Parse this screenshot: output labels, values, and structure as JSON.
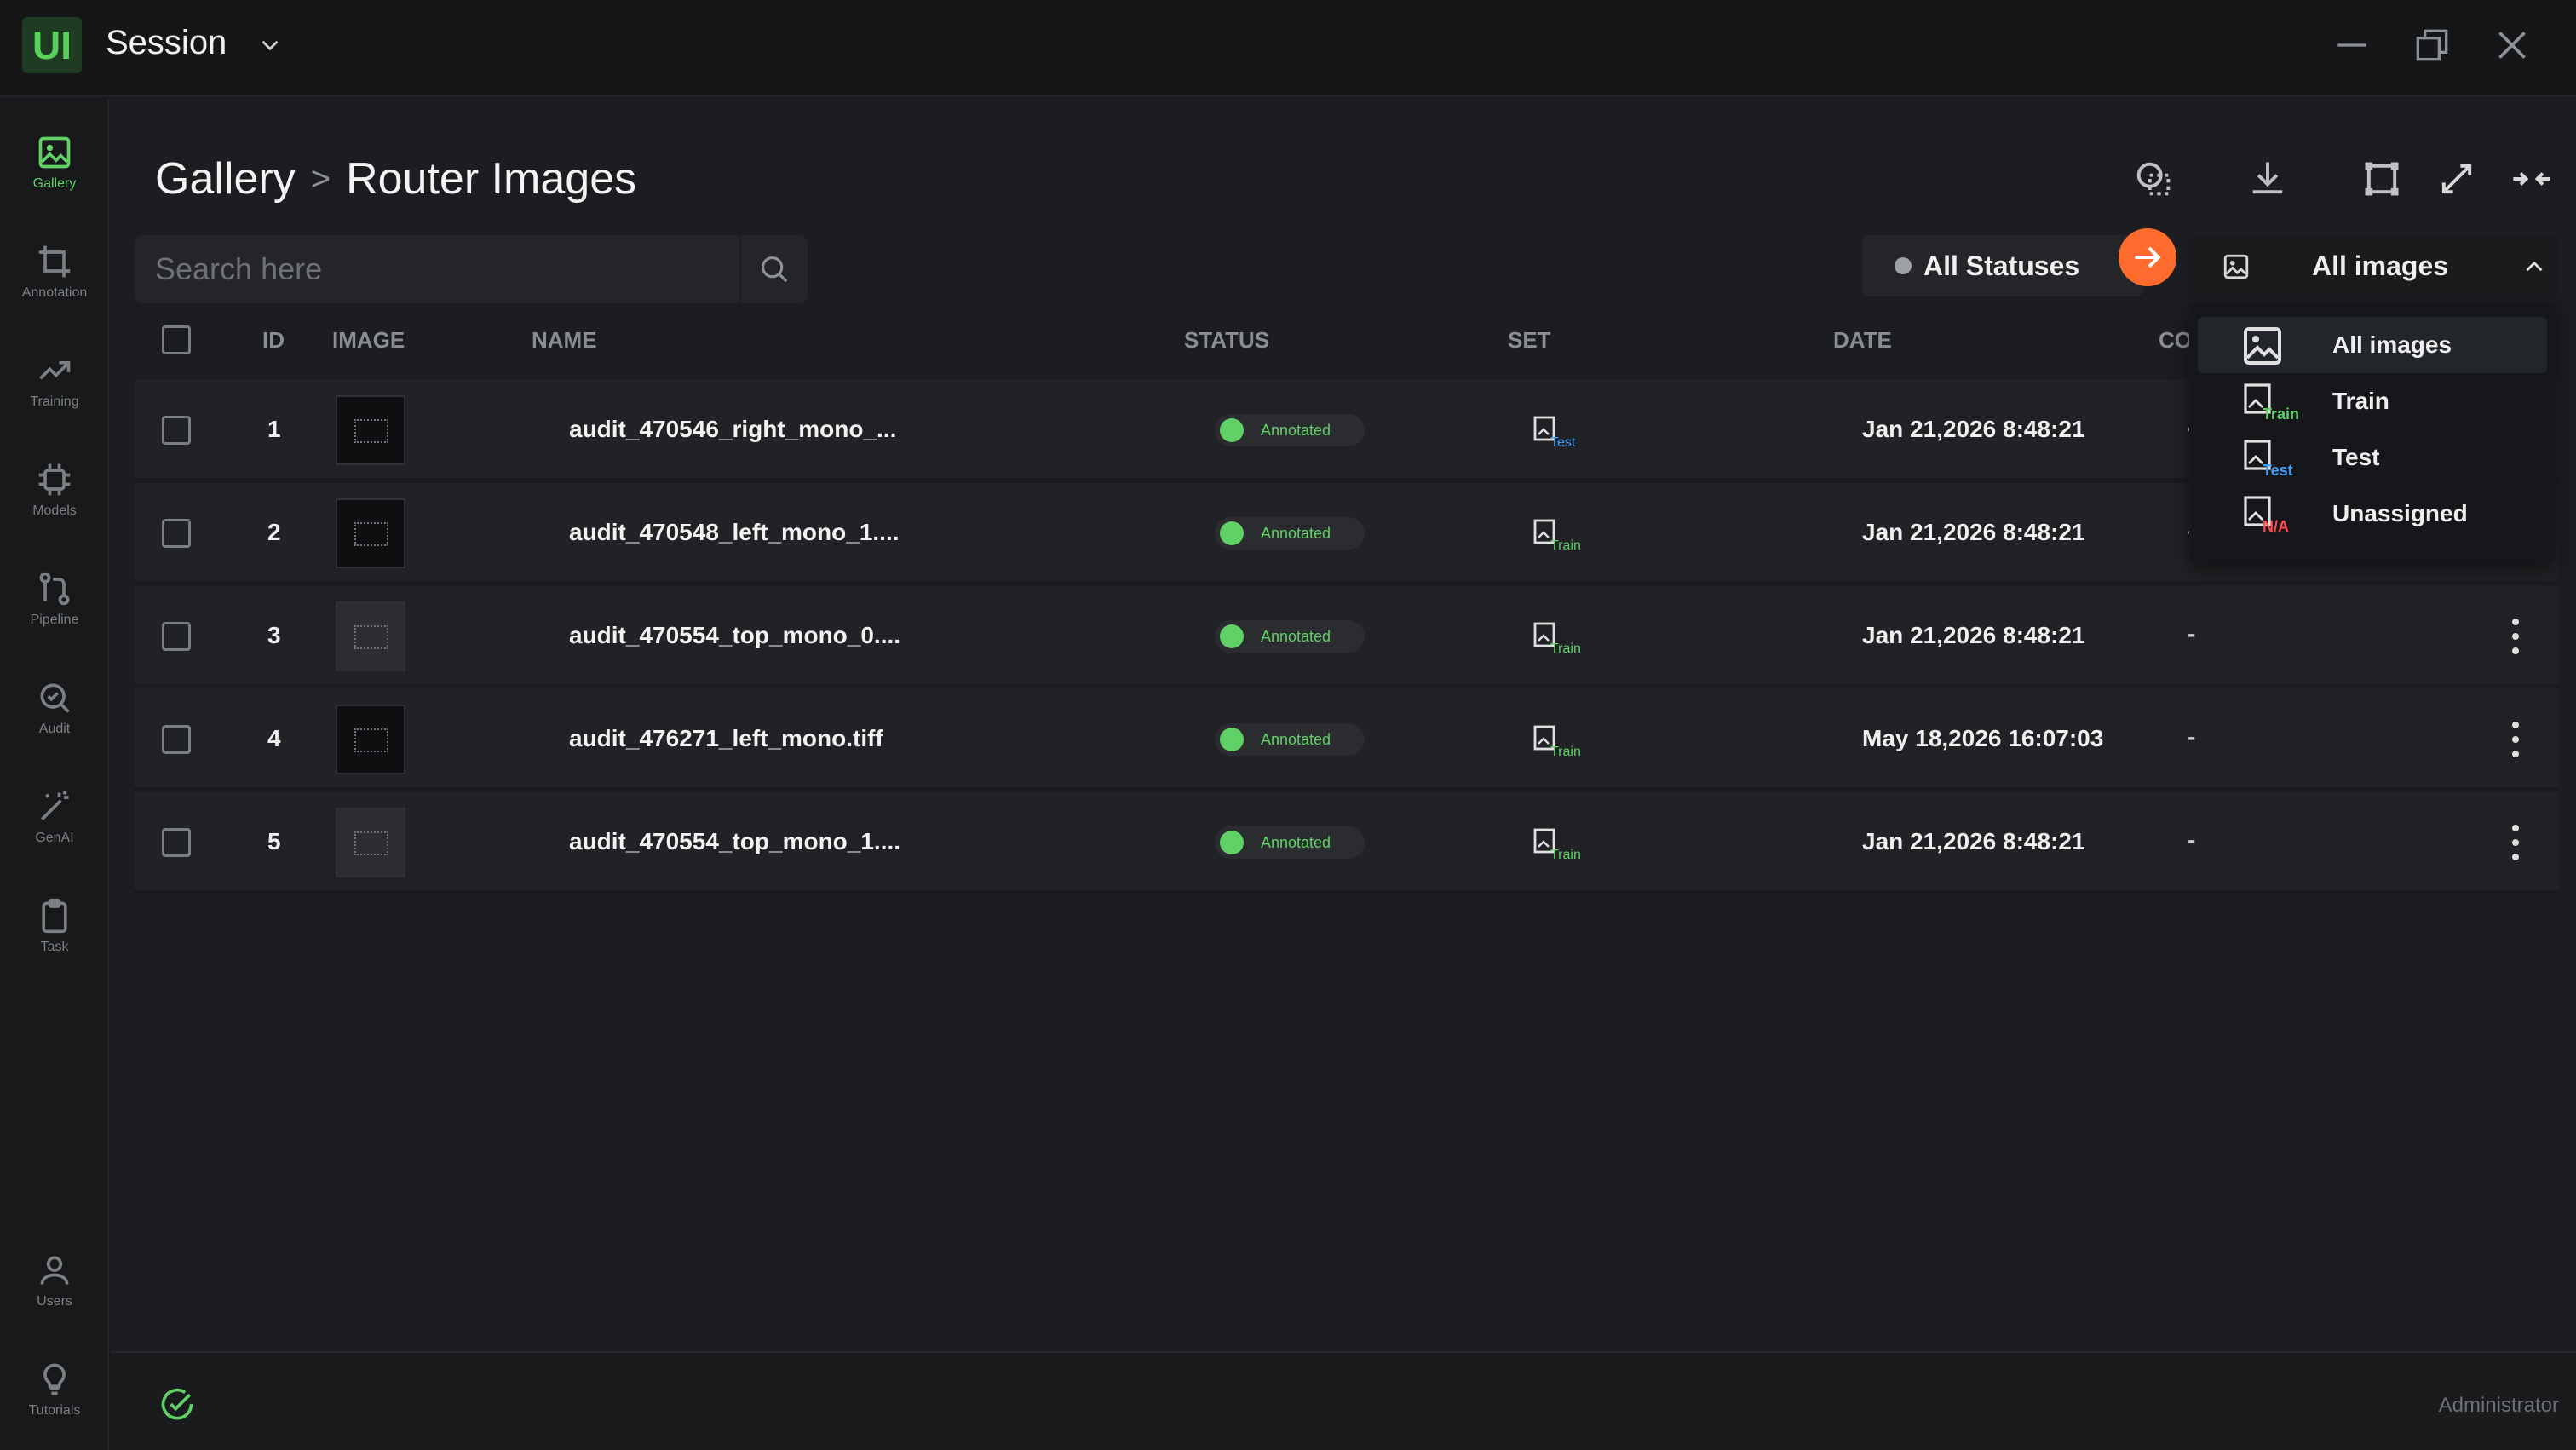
{
  "app": {
    "logo_text": "UI",
    "session_label": "Session"
  },
  "sidebar": {
    "items": [
      {
        "label": "Gallery",
        "icon": "gallery-icon",
        "active": true
      },
      {
        "label": "Annotation",
        "icon": "crop-icon"
      },
      {
        "label": "Training",
        "icon": "trend-icon"
      },
      {
        "label": "Models",
        "icon": "chip-icon"
      },
      {
        "label": "Pipeline",
        "icon": "pipeline-icon"
      },
      {
        "label": "Audit",
        "icon": "audit-search-icon"
      },
      {
        "label": "GenAI",
        "icon": "wand-icon"
      },
      {
        "label": "Task",
        "icon": "clipboard-icon"
      },
      {
        "label": "Users",
        "icon": "user-icon"
      },
      {
        "label": "Tutorials",
        "icon": "lightbulb-icon"
      }
    ]
  },
  "header": {
    "crumb_root": "Gallery",
    "crumb_sep": ">",
    "crumb_current": "Router Images"
  },
  "search": {
    "placeholder": "Search here"
  },
  "filters": {
    "status_label": "All Statuses",
    "images_label": "All images"
  },
  "table": {
    "columns": {
      "id": "ID",
      "image": "IMAGE",
      "name": "NAME",
      "status": "STATUS",
      "set": "SET",
      "date": "DATE",
      "co": "CO"
    },
    "rows": [
      {
        "id": "1",
        "name": "audit_470546_right_mono_...",
        "status": "Annotated",
        "set": "Test",
        "date": "Jan 21,2026 8:48:21",
        "co": "-"
      },
      {
        "id": "2",
        "name": "audit_470548_left_mono_1....",
        "status": "Annotated",
        "set": "Train",
        "date": "Jan 21,2026 8:48:21",
        "co": "-"
      },
      {
        "id": "3",
        "name": "audit_470554_top_mono_0....",
        "status": "Annotated",
        "set": "Train",
        "date": "Jan 21,2026 8:48:21",
        "co": "-"
      },
      {
        "id": "4",
        "name": "audit_476271_left_mono.tiff",
        "status": "Annotated",
        "set": "Train",
        "date": "May 18,2026 16:07:03",
        "co": "-"
      },
      {
        "id": "5",
        "name": "audit_470554_top_mono_1....",
        "status": "Annotated",
        "set": "Train",
        "date": "Jan 21,2026 8:48:21",
        "co": "-"
      }
    ]
  },
  "dropdown": {
    "options": [
      {
        "label": "All images",
        "tag": "",
        "selected": true
      },
      {
        "label": "Train",
        "tag": "Train"
      },
      {
        "label": "Test",
        "tag": "Test"
      },
      {
        "label": "Unassigned",
        "tag": "N/A"
      }
    ]
  },
  "footer": {
    "role": "Administrator"
  },
  "colors": {
    "accent_green": "#5fd166",
    "accent_orange": "#ff6b2c",
    "test_blue": "#3aa0ff",
    "na_red": "#ff4a4a"
  }
}
